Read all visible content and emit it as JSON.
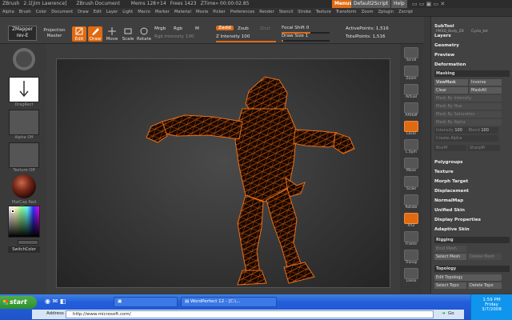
{
  "titlebar": {
    "app": "ZBrush",
    "doc": "2.1[Jim Lawrence]",
    "docname": "ZBrush Document",
    "mem": "Mems 128+14",
    "free": "Frees 1423",
    "ztime": "ZTime» 00:00:02.85",
    "menus_btn": "Menus",
    "script_btn": "Default2Script",
    "help_btn": "Help"
  },
  "menubar": [
    "Alpha",
    "Brush",
    "Color",
    "Document",
    "Draw",
    "Edit",
    "Layer",
    "Light",
    "Macro",
    "Marker",
    "Material",
    "Movie",
    "Picker",
    "Preferences",
    "Render",
    "Stencil",
    "Stroke",
    "Texture",
    "Transform",
    "Zoom",
    "Zplugin",
    "Zscript"
  ],
  "shelf": {
    "zmapper_label": "ZMapper",
    "zmapper_sub": "rev-E",
    "projection_label": "Projection",
    "master_label": "Master",
    "edit_label": "Edit",
    "draw_label": "Draw",
    "move_label": "Move",
    "scale_label": "Scale",
    "rotate_label": "Rotate",
    "mrgb_label": "Mrgb",
    "rgb_label": "Rgb",
    "m_label": "M",
    "zadd_label": "Zadd",
    "zsub_label": "Zsub",
    "zcut_label": "Zcut",
    "rgb_intensity_label": "Rgb Intensity",
    "rgb_intensity_value": "100",
    "z_intensity_label": "Z Intensity",
    "z_intensity_value": "100",
    "focal_shift_label": "Focal Shift",
    "focal_shift_value": "0",
    "draw_size_label": "Draw Size",
    "draw_size_value": "1",
    "active_points_label": "ActivePoints:",
    "active_points_value": "1,516",
    "total_points_label": "TotalPoints:",
    "total_points_value": "1,516"
  },
  "leftcol": {
    "swatch2_label": "DragRect",
    "swatch3_label": "Alpha Off",
    "swatch4_label": "Texture Off",
    "swatch5_label": "MatCap Red Wax",
    "switch_color": "SwitchColor"
  },
  "righttools": [
    "Scroll",
    "Zoom",
    "Actual",
    "AAHalf",
    "Local",
    "L.Sym",
    "Move",
    "Scale",
    "Rotate",
    "XYZ",
    "Frame",
    "Transp",
    "Lasso"
  ],
  "palette": {
    "top_items": [
      "PM3D_Body_Z8",
      "Cyclo_tet"
    ],
    "items_a": [
      "SubTool",
      "Layers",
      "Geometry",
      "Preview",
      "Deformation"
    ],
    "masking_header": "Masking",
    "viewmask": "ViewMask",
    "inverse": "Inverse",
    "clear": "Clear",
    "maskall": "MaskAll",
    "mask_dim": [
      "Mask By Intensity",
      "Mask By Hue",
      "Mask By Saturation",
      "Mask By Alpha"
    ],
    "intensity_label": "Intensity",
    "intensity_value": "100",
    "blend_label": "Blend",
    "blend_value": "100",
    "create_alpha": "Create Alpha",
    "blurm": "BlurM",
    "sharpm": "SharpM",
    "items_b": [
      "Polygroups",
      "Texture",
      "Morph Target",
      "Displacement",
      "NormalMap",
      "Unified Skin",
      "Display Properties",
      "Adaptive Skin"
    ],
    "rigging_header": "Rigging",
    "bind_mesh": "Bind Mesh",
    "select_mesh": "Select Mesh",
    "delete_mesh": "Delete Mesh",
    "topology_header": "Topology",
    "edit_topology": "Edit Topology",
    "select_topo": "Select Topo",
    "delete_topo": "Delete Topo"
  },
  "taskbar": {
    "start": "start",
    "wordperfect": "WordPerfect 12 - [C:\\...",
    "address_label": "Address",
    "address_value": "http://www.microsoft.com/",
    "go": "Go",
    "time": "1:59 PM",
    "day": "Friday",
    "date": "3/7/2008"
  },
  "colors": {
    "accent": "#e06a12",
    "mesh_fill": "#1a0800",
    "mesh_wire": "#d4600f",
    "taskbar": "#245edb"
  }
}
